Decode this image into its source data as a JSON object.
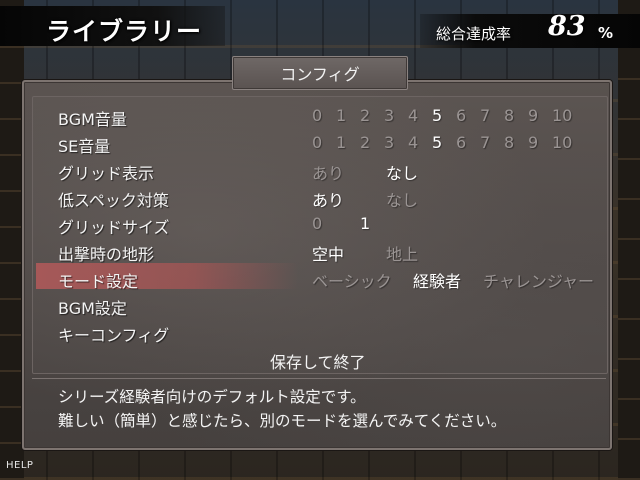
{
  "header": {
    "title": "ライブラリー",
    "completion_label": "総合達成率",
    "completion_value": "83",
    "completion_unit": "%"
  },
  "panel": {
    "tab_label": "コンフィグ",
    "rows": [
      {
        "label": "BGM音量",
        "options": [
          "0",
          "1",
          "2",
          "3",
          "4",
          "5",
          "6",
          "7",
          "8",
          "9",
          "10"
        ],
        "selected": "5"
      },
      {
        "label": "SE音量",
        "options": [
          "0",
          "1",
          "2",
          "3",
          "4",
          "5",
          "6",
          "7",
          "8",
          "9",
          "10"
        ],
        "selected": "5"
      },
      {
        "label": "グリッド表示",
        "options": [
          "あり",
          "なし"
        ],
        "selected": "なし"
      },
      {
        "label": "低スペック対策",
        "options": [
          "あり",
          "なし"
        ],
        "selected": "あり"
      },
      {
        "label": "グリッドサイズ",
        "options": [
          "0",
          "1"
        ],
        "selected": "1"
      },
      {
        "label": "出撃時の地形",
        "options": [
          "空中",
          "地上"
        ],
        "selected": "空中"
      },
      {
        "label": "モード設定",
        "options": [
          "ベーシック",
          "経験者",
          "チャレンジャー"
        ],
        "selected": "経験者",
        "highlighted": true
      },
      {
        "label": "BGM設定"
      },
      {
        "label": "キーコンフィグ"
      }
    ],
    "save_label": "保存して終了",
    "description": [
      "シリーズ経験者向けのデフォルト設定です。",
      "難しい（簡単）と感じたら、別のモードを選んでみてください。"
    ]
  },
  "footer": {
    "help_label": "HELP"
  },
  "colors": {
    "selected_option": "#ffffff",
    "unselected_option": "#9a9493",
    "highlight": "#b45a5a",
    "panel": "#524b49"
  }
}
